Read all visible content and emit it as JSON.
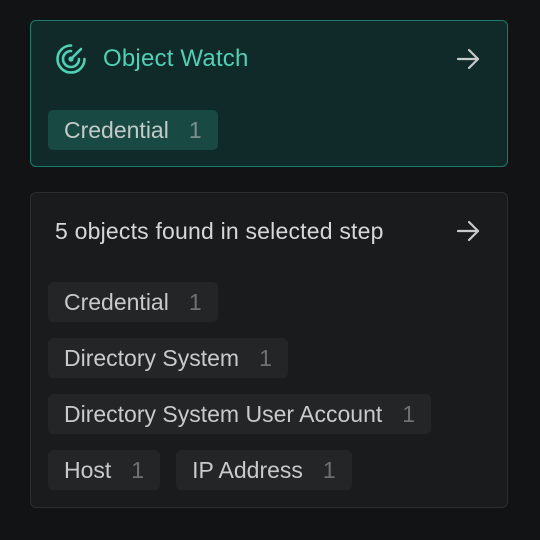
{
  "object_watch": {
    "title": "Object Watch",
    "icon": "radar-icon",
    "accent": "#4fd1b7",
    "chips": [
      {
        "label": "Credential",
        "count": "1"
      }
    ]
  },
  "found": {
    "title": "5 objects found in selected step",
    "chips": [
      {
        "label": "Credential",
        "count": "1"
      },
      {
        "label": "Directory System",
        "count": "1"
      },
      {
        "label": "Directory System User Account",
        "count": "1"
      },
      {
        "label": "Host",
        "count": "1"
      },
      {
        "label": "IP Address",
        "count": "1"
      }
    ]
  }
}
